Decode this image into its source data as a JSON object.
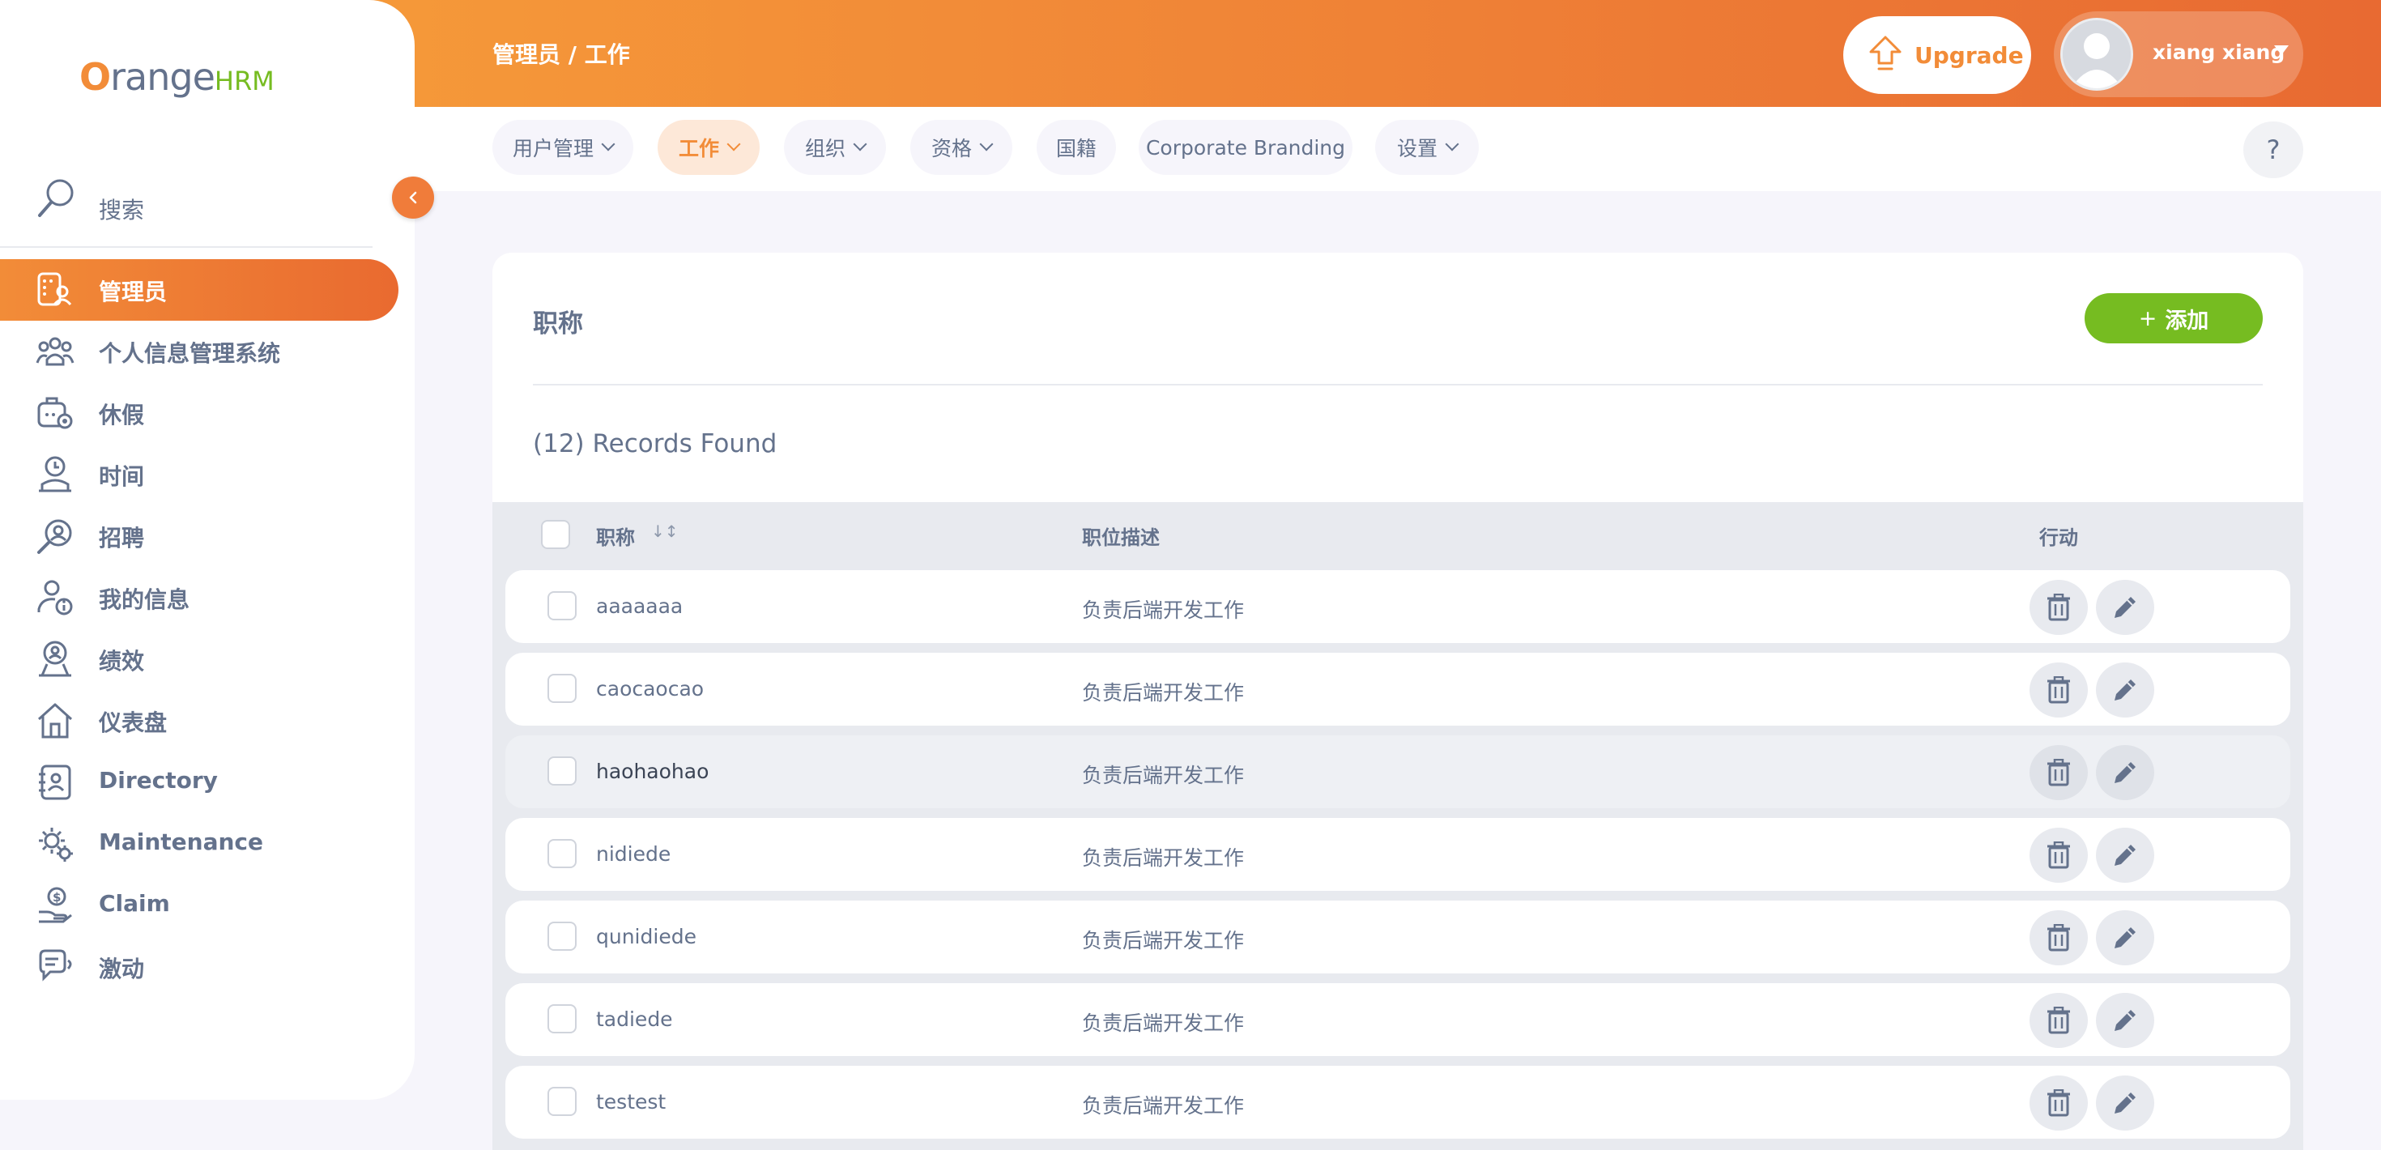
{
  "brand": {
    "logo_prefix": "O",
    "logo_main": "range",
    "logo_suffix": "HRM"
  },
  "sidebar": {
    "search_label": "搜索",
    "items": [
      {
        "label": "管理员",
        "icon": "admin-icon",
        "active": true
      },
      {
        "label": "个人信息管理系统",
        "icon": "pim-icon",
        "active": false
      },
      {
        "label": "休假",
        "icon": "leave-icon",
        "active": false
      },
      {
        "label": "时间",
        "icon": "time-icon",
        "active": false
      },
      {
        "label": "招聘",
        "icon": "recruitment-icon",
        "active": false
      },
      {
        "label": "我的信息",
        "icon": "my-info-icon",
        "active": false
      },
      {
        "label": "绩效",
        "icon": "performance-icon",
        "active": false
      },
      {
        "label": "仪表盘",
        "icon": "dashboard-icon",
        "active": false
      },
      {
        "label": "Directory",
        "icon": "directory-icon",
        "active": false
      },
      {
        "label": "Maintenance",
        "icon": "maintenance-icon",
        "active": false
      },
      {
        "label": "Claim",
        "icon": "claim-icon",
        "active": false
      },
      {
        "label": "激动",
        "icon": "buzz-icon",
        "active": false
      }
    ]
  },
  "header": {
    "breadcrumb": "管理员 / 工作",
    "upgrade_label": "Upgrade",
    "user_name": "xiang xiang",
    "help_label": "?"
  },
  "topnav": {
    "tabs": [
      {
        "label": "用户管理",
        "dropdown": true,
        "active": false
      },
      {
        "label": "工作",
        "dropdown": true,
        "active": true
      },
      {
        "label": "组织",
        "dropdown": true,
        "active": false
      },
      {
        "label": "资格",
        "dropdown": true,
        "active": false
      },
      {
        "label": "国籍",
        "dropdown": false,
        "active": false
      },
      {
        "label": "Corporate Branding",
        "dropdown": false,
        "active": false
      },
      {
        "label": "设置",
        "dropdown": true,
        "active": false
      }
    ]
  },
  "main": {
    "title": "职称",
    "add_label": "添加",
    "records_found": "(12) Records Found",
    "columns": {
      "title": "职称",
      "description": "职位描述",
      "actions": "行动"
    },
    "rows": [
      {
        "title": "aaaaaaa",
        "description": "负责后端开发工作"
      },
      {
        "title": "caocaocao",
        "description": "负责后端开发工作"
      },
      {
        "title": "haohaohao",
        "description": "负责后端开发工作"
      },
      {
        "title": "nidiede",
        "description": "负责后端开发工作"
      },
      {
        "title": "qunidiede",
        "description": "负责后端开发工作"
      },
      {
        "title": "tadiede",
        "description": "负责后端开发工作"
      },
      {
        "title": "testest",
        "description": "负责后端开发工作"
      }
    ]
  },
  "colors": {
    "accent": "#f28c38",
    "accent_dark": "#e86a32",
    "green": "#76bc21",
    "text": "#64728c"
  }
}
